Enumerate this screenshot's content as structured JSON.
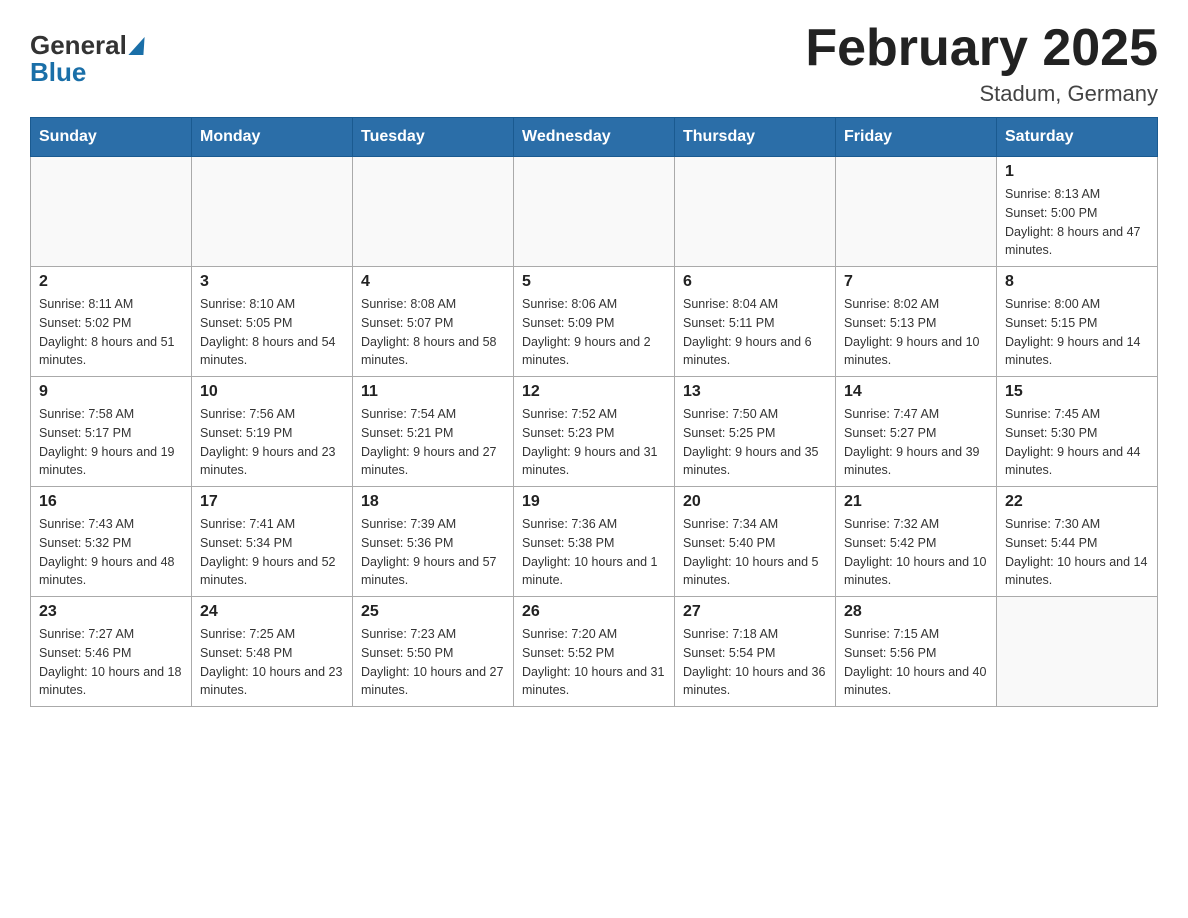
{
  "header": {
    "title": "February 2025",
    "subtitle": "Stadum, Germany"
  },
  "logo": {
    "line1": "General",
    "line2": "Blue"
  },
  "weekdays": [
    "Sunday",
    "Monday",
    "Tuesday",
    "Wednesday",
    "Thursday",
    "Friday",
    "Saturday"
  ],
  "weeks": [
    [
      {
        "day": "",
        "info": ""
      },
      {
        "day": "",
        "info": ""
      },
      {
        "day": "",
        "info": ""
      },
      {
        "day": "",
        "info": ""
      },
      {
        "day": "",
        "info": ""
      },
      {
        "day": "",
        "info": ""
      },
      {
        "day": "1",
        "info": "Sunrise: 8:13 AM\nSunset: 5:00 PM\nDaylight: 8 hours and 47 minutes."
      }
    ],
    [
      {
        "day": "2",
        "info": "Sunrise: 8:11 AM\nSunset: 5:02 PM\nDaylight: 8 hours and 51 minutes."
      },
      {
        "day": "3",
        "info": "Sunrise: 8:10 AM\nSunset: 5:05 PM\nDaylight: 8 hours and 54 minutes."
      },
      {
        "day": "4",
        "info": "Sunrise: 8:08 AM\nSunset: 5:07 PM\nDaylight: 8 hours and 58 minutes."
      },
      {
        "day": "5",
        "info": "Sunrise: 8:06 AM\nSunset: 5:09 PM\nDaylight: 9 hours and 2 minutes."
      },
      {
        "day": "6",
        "info": "Sunrise: 8:04 AM\nSunset: 5:11 PM\nDaylight: 9 hours and 6 minutes."
      },
      {
        "day": "7",
        "info": "Sunrise: 8:02 AM\nSunset: 5:13 PM\nDaylight: 9 hours and 10 minutes."
      },
      {
        "day": "8",
        "info": "Sunrise: 8:00 AM\nSunset: 5:15 PM\nDaylight: 9 hours and 14 minutes."
      }
    ],
    [
      {
        "day": "9",
        "info": "Sunrise: 7:58 AM\nSunset: 5:17 PM\nDaylight: 9 hours and 19 minutes."
      },
      {
        "day": "10",
        "info": "Sunrise: 7:56 AM\nSunset: 5:19 PM\nDaylight: 9 hours and 23 minutes."
      },
      {
        "day": "11",
        "info": "Sunrise: 7:54 AM\nSunset: 5:21 PM\nDaylight: 9 hours and 27 minutes."
      },
      {
        "day": "12",
        "info": "Sunrise: 7:52 AM\nSunset: 5:23 PM\nDaylight: 9 hours and 31 minutes."
      },
      {
        "day": "13",
        "info": "Sunrise: 7:50 AM\nSunset: 5:25 PM\nDaylight: 9 hours and 35 minutes."
      },
      {
        "day": "14",
        "info": "Sunrise: 7:47 AM\nSunset: 5:27 PM\nDaylight: 9 hours and 39 minutes."
      },
      {
        "day": "15",
        "info": "Sunrise: 7:45 AM\nSunset: 5:30 PM\nDaylight: 9 hours and 44 minutes."
      }
    ],
    [
      {
        "day": "16",
        "info": "Sunrise: 7:43 AM\nSunset: 5:32 PM\nDaylight: 9 hours and 48 minutes."
      },
      {
        "day": "17",
        "info": "Sunrise: 7:41 AM\nSunset: 5:34 PM\nDaylight: 9 hours and 52 minutes."
      },
      {
        "day": "18",
        "info": "Sunrise: 7:39 AM\nSunset: 5:36 PM\nDaylight: 9 hours and 57 minutes."
      },
      {
        "day": "19",
        "info": "Sunrise: 7:36 AM\nSunset: 5:38 PM\nDaylight: 10 hours and 1 minute."
      },
      {
        "day": "20",
        "info": "Sunrise: 7:34 AM\nSunset: 5:40 PM\nDaylight: 10 hours and 5 minutes."
      },
      {
        "day": "21",
        "info": "Sunrise: 7:32 AM\nSunset: 5:42 PM\nDaylight: 10 hours and 10 minutes."
      },
      {
        "day": "22",
        "info": "Sunrise: 7:30 AM\nSunset: 5:44 PM\nDaylight: 10 hours and 14 minutes."
      }
    ],
    [
      {
        "day": "23",
        "info": "Sunrise: 7:27 AM\nSunset: 5:46 PM\nDaylight: 10 hours and 18 minutes."
      },
      {
        "day": "24",
        "info": "Sunrise: 7:25 AM\nSunset: 5:48 PM\nDaylight: 10 hours and 23 minutes."
      },
      {
        "day": "25",
        "info": "Sunrise: 7:23 AM\nSunset: 5:50 PM\nDaylight: 10 hours and 27 minutes."
      },
      {
        "day": "26",
        "info": "Sunrise: 7:20 AM\nSunset: 5:52 PM\nDaylight: 10 hours and 31 minutes."
      },
      {
        "day": "27",
        "info": "Sunrise: 7:18 AM\nSunset: 5:54 PM\nDaylight: 10 hours and 36 minutes."
      },
      {
        "day": "28",
        "info": "Sunrise: 7:15 AM\nSunset: 5:56 PM\nDaylight: 10 hours and 40 minutes."
      },
      {
        "day": "",
        "info": ""
      }
    ]
  ]
}
